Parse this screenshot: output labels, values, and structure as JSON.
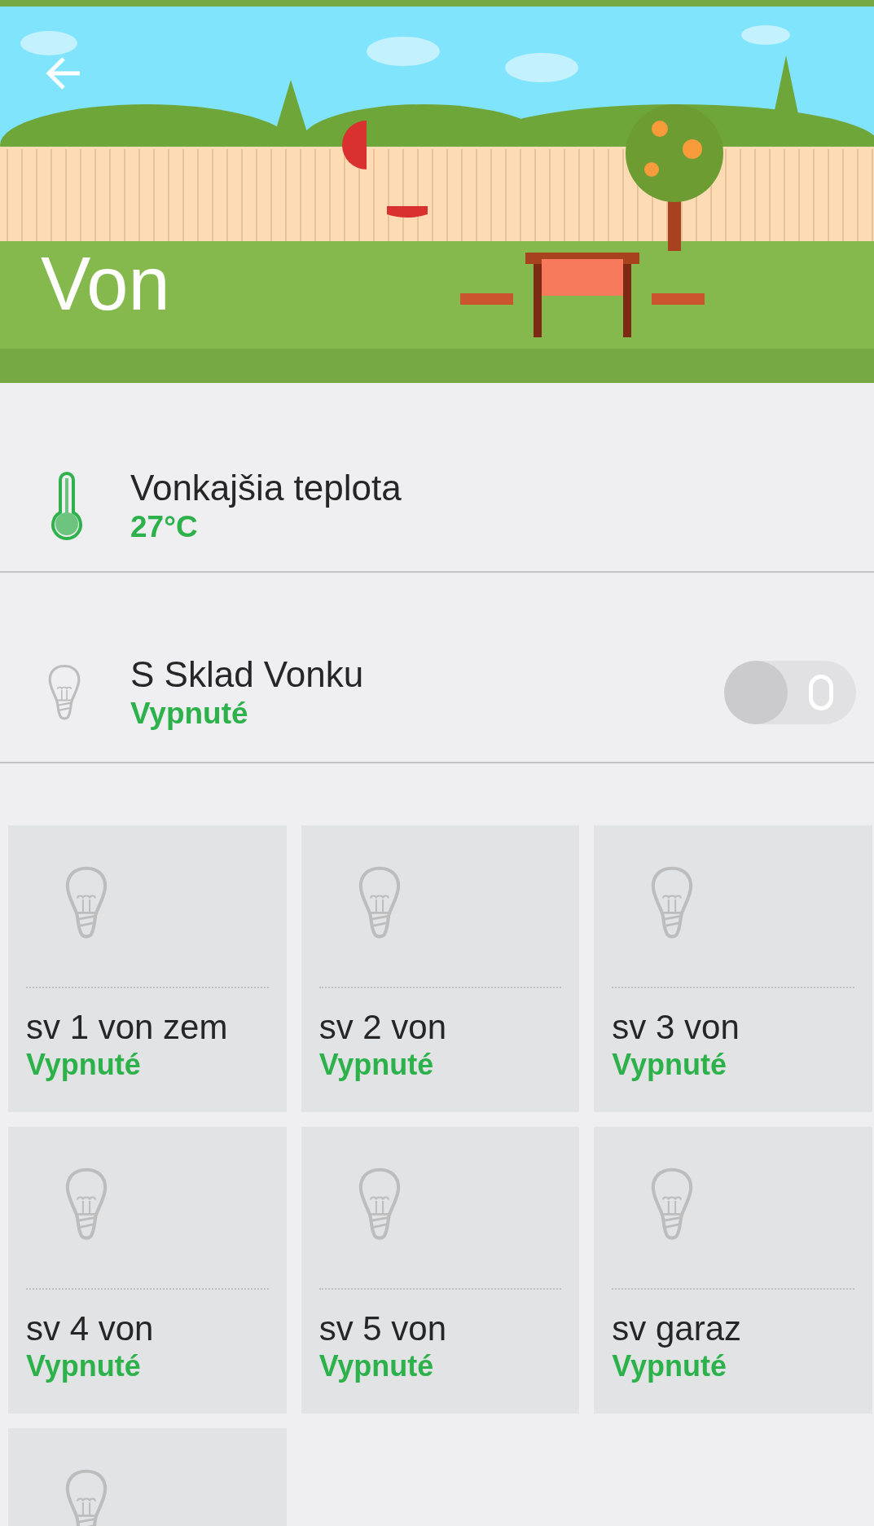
{
  "header": {
    "title": "Von"
  },
  "rows": [
    {
      "kind": "sensor",
      "name": "Vonkajšia teplota",
      "value": "27°C"
    },
    {
      "kind": "switch",
      "name": "S Sklad Vonku",
      "value": "Vypnuté",
      "on": false
    }
  ],
  "tiles": [
    {
      "kind": "light",
      "name": "sv 1 von zem",
      "status": "Vypnuté"
    },
    {
      "kind": "light",
      "name": "sv 2 von",
      "status": "Vypnuté"
    },
    {
      "kind": "light",
      "name": "sv 3 von",
      "status": "Vypnuté"
    },
    {
      "kind": "light",
      "name": "sv 4 von",
      "status": "Vypnuté"
    },
    {
      "kind": "light",
      "name": "sv 5 von",
      "status": "Vypnuté"
    },
    {
      "kind": "light",
      "name": "sv garaz",
      "status": "Vypnuté"
    },
    {
      "kind": "light"
    }
  ]
}
